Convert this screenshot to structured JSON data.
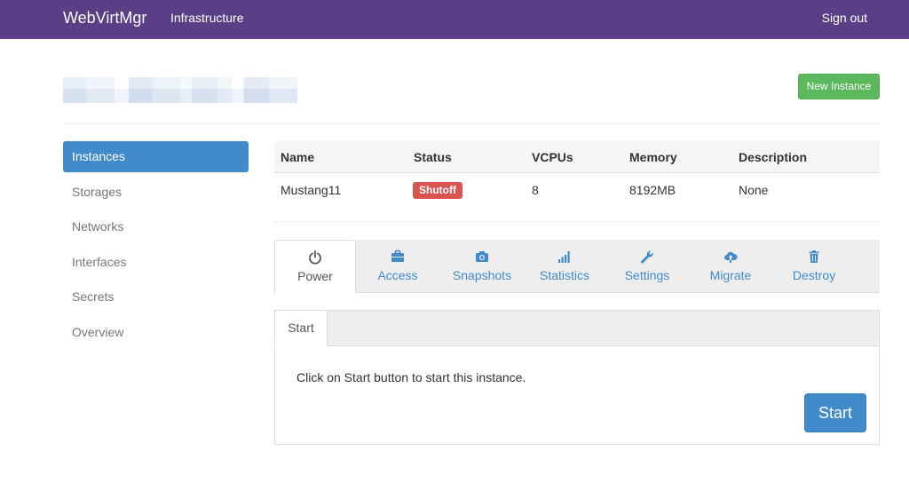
{
  "navbar": {
    "brand": "WebVirtMgr",
    "link": "Infrastructure",
    "signout": "Sign out"
  },
  "header": {
    "new_instance_label": "New Instance"
  },
  "sidebar": {
    "items": [
      {
        "label": "Instances",
        "active": true
      },
      {
        "label": "Storages"
      },
      {
        "label": "Networks"
      },
      {
        "label": "Interfaces"
      },
      {
        "label": "Secrets"
      },
      {
        "label": "Overview"
      }
    ]
  },
  "instances_table": {
    "columns": [
      "Name",
      "Status",
      "VCPUs",
      "Memory",
      "Description"
    ],
    "rows": [
      {
        "name": "Mustang11",
        "status": "Shutoff",
        "vcpus": "8",
        "memory": "8192MB",
        "description": "None"
      }
    ]
  },
  "tabs": [
    {
      "label": "Power",
      "icon": "power-icon",
      "active": true
    },
    {
      "label": "Access",
      "icon": "briefcase-icon"
    },
    {
      "label": "Snapshots",
      "icon": "camera-icon"
    },
    {
      "label": "Statistics",
      "icon": "signal-bars-icon"
    },
    {
      "label": "Settings",
      "icon": "wrench-icon"
    },
    {
      "label": "Migrate",
      "icon": "cloud-upload-icon"
    },
    {
      "label": "Destroy",
      "icon": "trash-icon"
    }
  ],
  "power": {
    "subtab": "Start",
    "message": "Click on Start button to start this instance.",
    "start_label": "Start"
  },
  "colors": {
    "navbar": "#5b3e86",
    "primary": "#428bca",
    "success": "#5cb85c",
    "danger": "#d9534f"
  }
}
